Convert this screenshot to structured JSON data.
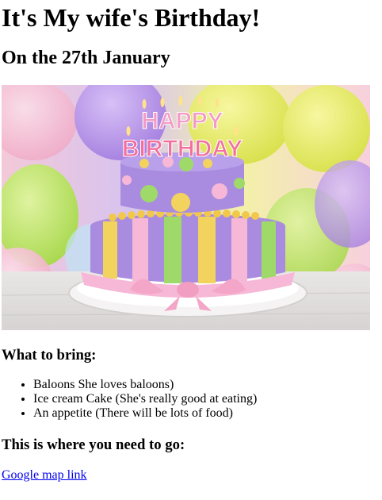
{
  "page": {
    "title": "It's My wife's Birthday!",
    "subtitle": "On the 27th January"
  },
  "photo": {
    "cake_text_top": "HAPPY",
    "cake_text_bottom": "BIRTHDAY",
    "colors": {
      "background_yellow": "#e8ee6a",
      "balloon_purple": "#b58ee8",
      "cake_purple": "#a98ce0",
      "ribbon_pink": "#f6b8d6",
      "stripe_yellow": "#f2d35e",
      "stripe_green": "#9ed96a",
      "plate_white": "#f4f2f2"
    }
  },
  "bring": {
    "heading": "What to bring:",
    "items": [
      "Baloons She loves baloons)",
      "Ice cream Cake (She's really good at eating)",
      "An appetite (There will be lots of food)"
    ]
  },
  "directions": {
    "heading": "This is where you need to go:",
    "link_text": "Google map link",
    "link_color": "#0000ee"
  }
}
